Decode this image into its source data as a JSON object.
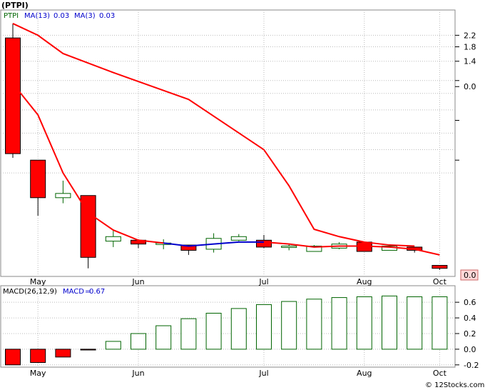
{
  "chart_data": [
    {
      "type": "candlestick",
      "title": "(PTPI)",
      "legend": {
        "symbol": "PTPI",
        "ma13_label": "MA(13)",
        "ma13_value": "0.03",
        "ma3_label": "MA(3)",
        "ma3_value": "0.03"
      },
      "y_ticks": [
        "2.2",
        "1.8",
        "1.4",
        "0.0",
        "0.0"
      ],
      "x_ticks": [
        "May",
        "Jun",
        "Jul",
        "Aug",
        "Oct"
      ],
      "candles": [
        {
          "open": 2.1,
          "close": 0.28,
          "high": 2.7,
          "low": 0.26,
          "dir": "down"
        },
        {
          "open": 0.25,
          "close": 0.13,
          "high": 0.25,
          "low": 0.095,
          "dir": "down"
        },
        {
          "open": 0.13,
          "close": 0.14,
          "high": 0.175,
          "low": 0.118,
          "dir": "up"
        },
        {
          "open": 0.135,
          "close": 0.046,
          "high": 0.135,
          "low": 0.038,
          "dir": "down"
        },
        {
          "open": 0.061,
          "close": 0.066,
          "high": 0.073,
          "low": 0.055,
          "dir": "up"
        },
        {
          "open": 0.062,
          "close": 0.058,
          "high": 0.063,
          "low": 0.054,
          "dir": "down"
        },
        {
          "open": 0.059,
          "close": 0.058,
          "high": 0.063,
          "low": 0.053,
          "dir": "up"
        },
        {
          "open": 0.057,
          "close": 0.052,
          "high": 0.057,
          "low": 0.048,
          "dir": "down"
        },
        {
          "open": 0.053,
          "close": 0.064,
          "high": 0.07,
          "low": 0.05,
          "dir": "up"
        },
        {
          "open": 0.062,
          "close": 0.066,
          "high": 0.069,
          "low": 0.061,
          "dir": "up"
        },
        {
          "open": 0.062,
          "close": 0.055,
          "high": 0.068,
          "low": 0.054,
          "dir": "down"
        },
        {
          "open": 0.056,
          "close": 0.056,
          "high": 0.058,
          "low": 0.052,
          "dir": "up"
        },
        {
          "open": 0.051,
          "close": 0.056,
          "high": 0.057,
          "low": 0.051,
          "dir": "up"
        },
        {
          "open": 0.054,
          "close": 0.058,
          "high": 0.06,
          "low": 0.053,
          "dir": "up"
        },
        {
          "open": 0.06,
          "close": 0.051,
          "high": 0.06,
          "low": 0.051,
          "dir": "down"
        },
        {
          "open": 0.052,
          "close": 0.056,
          "high": 0.057,
          "low": 0.052,
          "dir": "up"
        },
        {
          "open": 0.055,
          "close": 0.052,
          "high": 0.055,
          "low": 0.05,
          "dir": "down"
        },
        {
          "open": 0.04,
          "close": 0.038,
          "high": 0.04,
          "low": 0.037,
          "dir": "down"
        }
      ],
      "ma13_path": [
        {
          "x": 0,
          "y": 2.7
        },
        {
          "x": 1,
          "y": 2.2
        },
        {
          "x": 2,
          "y": 1.6
        },
        {
          "x": 4,
          "y": 1.15
        },
        {
          "x": 7,
          "y": 0.72
        },
        {
          "x": 10,
          "y": 0.3
        },
        {
          "x": 11,
          "y": 0.16
        },
        {
          "x": 12,
          "y": 0.075
        },
        {
          "x": 13,
          "y": 0.066
        },
        {
          "x": 14,
          "y": 0.06
        },
        {
          "x": 15,
          "y": 0.057
        },
        {
          "x": 16,
          "y": 0.056
        }
      ],
      "ma3_path": [
        {
          "x": 0,
          "y": 0.95
        },
        {
          "x": 1,
          "y": 0.55
        },
        {
          "x": 2,
          "y": 0.2
        },
        {
          "x": 3,
          "y": 0.1
        },
        {
          "x": 4,
          "y": 0.074
        },
        {
          "x": 5,
          "y": 0.062
        },
        {
          "x": 6,
          "y": 0.059
        },
        {
          "x": 7,
          "y": 0.056
        },
        {
          "x": 8,
          "y": 0.058
        },
        {
          "x": 9,
          "y": 0.06
        },
        {
          "x": 10,
          "y": 0.06
        },
        {
          "x": 11,
          "y": 0.058
        },
        {
          "x": 12,
          "y": 0.055
        },
        {
          "x": 13,
          "y": 0.056
        },
        {
          "x": 14,
          "y": 0.056
        },
        {
          "x": 15,
          "y": 0.055
        },
        {
          "x": 16,
          "y": 0.053
        },
        {
          "x": 17,
          "y": 0.048
        }
      ],
      "ma3_blue_segment": [
        6,
        10
      ],
      "last_value_label": "0.0"
    },
    {
      "type": "bar",
      "title": "MACD(26,12,9)",
      "macd_label": "MACD",
      "macd_value": "0.67",
      "y_ticks": [
        "0.6",
        "0.4",
        "0.2",
        "0.0",
        "-0.2"
      ],
      "x_ticks": [
        "May",
        "Jun",
        "Jul",
        "Aug",
        "Oct"
      ],
      "ylim": [
        -0.2,
        0.7
      ],
      "values": [
        -0.2,
        -0.17,
        -0.1,
        -0.01,
        0.1,
        0.2,
        0.3,
        0.39,
        0.46,
        0.52,
        0.57,
        0.61,
        0.64,
        0.66,
        0.67,
        0.68,
        0.67,
        0.67
      ]
    }
  ],
  "colors": {
    "down": "#ff0000",
    "up_fill": "#ffffff",
    "up_stroke": "#006400",
    "ma13": "#ff0000",
    "ma3": "#ff0000",
    "ma3_blue": "#0000cc",
    "macd_pos_stroke": "#006400",
    "macd_neg_fill": "#ff0000",
    "grid": "#bbbbbb",
    "frame": "#888888",
    "title": "#000000",
    "legend_green": "#006400",
    "legend_blue": "#0000cc"
  },
  "footer": {
    "copyright": "© 12Stocks.com"
  }
}
